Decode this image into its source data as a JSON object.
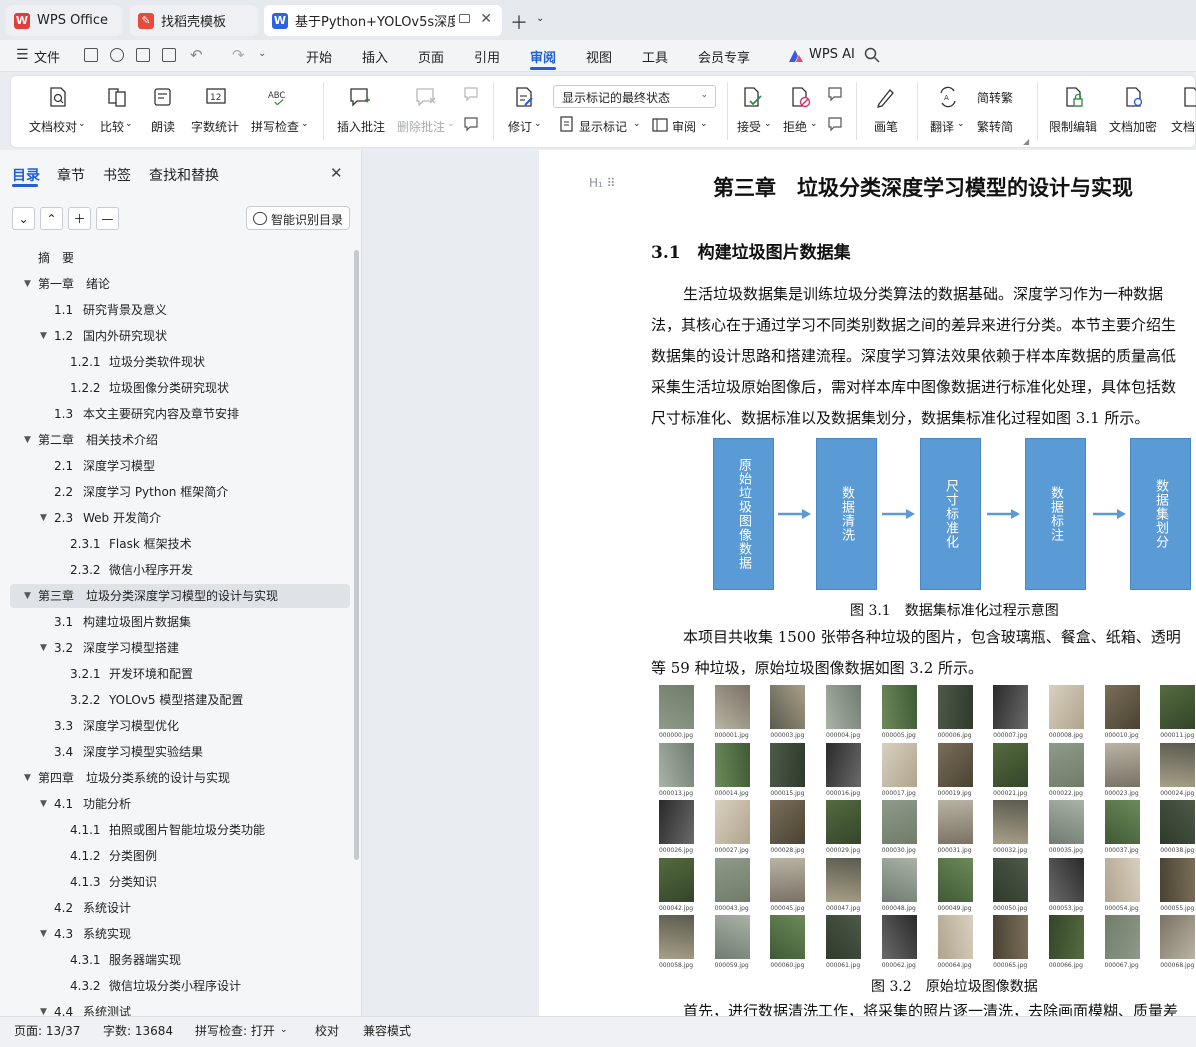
{
  "tabs": [
    {
      "label": "WPS Office",
      "icon": "wps-logo-icon",
      "color": "#e43b3b"
    },
    {
      "label": "找稻壳模板",
      "icon": "docer-logo-icon",
      "color": "#e84a3c"
    },
    {
      "label": "基于Python+YOLOv5s深度学",
      "icon": "writer-logo-icon",
      "color": "#2b63e0"
    }
  ],
  "menubar": {
    "file": "文件",
    "items": [
      "开始",
      "插入",
      "页面",
      "引用",
      "审阅",
      "视图",
      "工具",
      "会员专享"
    ],
    "active": "审阅",
    "ai": "WPS AI"
  },
  "ribbon": {
    "doc_check": "文档校对",
    "compare": "比较",
    "read_aloud": "朗读",
    "word_count": "字数统计",
    "spell_check": "拼写检查",
    "insert_comment": "插入批注",
    "delete_comment": "删除批注",
    "track_changes": "修订",
    "markup_select": "显示标记的最终状态",
    "show_markup": "显示标记",
    "review": "审阅",
    "accept": "接受",
    "reject": "拒绝",
    "pen": "画笔",
    "translate": "翻译",
    "to_traditional": "简转繁",
    "to_simplified": "繁转简",
    "restrict_edit": "限制编辑",
    "encrypt": "文档加密",
    "doc_more": "文档"
  },
  "navpane": {
    "tabs": [
      "目录",
      "章节",
      "书签",
      "查找和替换"
    ],
    "smart_toc": "智能识别目录",
    "toc": [
      {
        "num": "",
        "text": "摘　要",
        "level": 0,
        "arrow": false
      },
      {
        "num": "第一章",
        "text": "绪论",
        "level": 0,
        "arrow": true
      },
      {
        "num": "1.1",
        "text": "研究背景及意义",
        "level": 1,
        "arrow": false
      },
      {
        "num": "1.2",
        "text": "国内外研究现状",
        "level": 1,
        "arrow": true
      },
      {
        "num": "1.2.1",
        "text": "垃圾分类软件现状",
        "level": 2,
        "arrow": false
      },
      {
        "num": "1.2.2",
        "text": "垃圾图像分类研究现状",
        "level": 2,
        "arrow": false
      },
      {
        "num": "1.3",
        "text": "本文主要研究内容及章节安排",
        "level": 1,
        "arrow": false
      },
      {
        "num": "第二章",
        "text": "相关技术介绍",
        "level": 0,
        "arrow": true
      },
      {
        "num": "2.1",
        "text": "深度学习模型",
        "level": 1,
        "arrow": false
      },
      {
        "num": "2.2",
        "text": "深度学习 Python 框架简介",
        "level": 1,
        "arrow": false
      },
      {
        "num": "2.3",
        "text": "Web 开发简介",
        "level": 1,
        "arrow": true
      },
      {
        "num": "2.3.1",
        "text": "Flask 框架技术",
        "level": 2,
        "arrow": false
      },
      {
        "num": "2.3.2",
        "text": "微信小程序开发",
        "level": 2,
        "arrow": false
      },
      {
        "num": "第三章",
        "text": "垃圾分类深度学习模型的设计与实现",
        "level": 0,
        "arrow": true,
        "selected": true
      },
      {
        "num": "3.1",
        "text": "构建垃圾图片数据集",
        "level": 1,
        "arrow": false
      },
      {
        "num": "3.2",
        "text": "深度学习模型搭建",
        "level": 1,
        "arrow": true
      },
      {
        "num": "3.2.1",
        "text": "开发环境和配置",
        "level": 2,
        "arrow": false
      },
      {
        "num": "3.2.2",
        "text": "YOLOv5 模型搭建及配置",
        "level": 2,
        "arrow": false
      },
      {
        "num": "3.3",
        "text": "深度学习模型优化",
        "level": 1,
        "arrow": false
      },
      {
        "num": "3.4",
        "text": "深度学习模型实验结果",
        "level": 1,
        "arrow": false
      },
      {
        "num": "第四章",
        "text": "垃圾分类系统的设计与实现",
        "level": 0,
        "arrow": true
      },
      {
        "num": "4.1",
        "text": "功能分析",
        "level": 1,
        "arrow": true
      },
      {
        "num": "4.1.1",
        "text": "拍照或图片智能垃圾分类功能",
        "level": 2,
        "arrow": false
      },
      {
        "num": "4.1.2",
        "text": "分类图例",
        "level": 2,
        "arrow": false
      },
      {
        "num": "4.1.3",
        "text": "分类知识",
        "level": 2,
        "arrow": false
      },
      {
        "num": "4.2",
        "text": "系统设计",
        "level": 1,
        "arrow": false
      },
      {
        "num": "4.3",
        "text": "系统实现",
        "level": 1,
        "arrow": true
      },
      {
        "num": "4.3.1",
        "text": "服务器端实现",
        "level": 2,
        "arrow": false
      },
      {
        "num": "4.3.2",
        "text": "微信垃圾分类小程序设计",
        "level": 2,
        "arrow": false
      },
      {
        "num": "4.4",
        "text": "系统测试",
        "level": 1,
        "arrow": true
      }
    ]
  },
  "document": {
    "chapter_title": "第三章　垃圾分类深度学习模型的设计与实现",
    "section_title": "3.1　构建垃圾图片数据集",
    "para1": [
      "生活垃圾数据集是训练垃圾分类算法的数据基础。深度学习作为一种数据",
      "法，其核心在于通过学习不同类别数据之间的差异来进行分类。本节主要介绍生",
      "数据集的设计思路和搭建流程。深度学习算法效果依赖于样本库数据的质量高低",
      "采集生活垃圾原始图像后，需对样本库中图像数据进行标准化处理，具体包括数",
      "尺寸标准化、数据标准以及数据集划分，数据集标准化过程如图 3.1 所示。"
    ],
    "flow_steps": [
      "原始垃圾图像数据",
      "数据清洗",
      "尺寸标准化",
      "数据标注",
      "数据集划分"
    ],
    "fig1_caption": "图 3.1　数据集标准化过程示意图",
    "para2": [
      "本项目共收集 1500 张带各种垃圾的图片，包含玻璃瓶、餐盒、纸箱、透明",
      "等 59 种垃圾，原始垃圾图像数据如图 3.2 所示。"
    ],
    "thumbnails": [
      [
        "000000.jpg",
        "000001.jpg",
        "000003.jpg",
        "000004.jpg",
        "000005.jpg",
        "000006.jpg",
        "000007.jpg",
        "000008.jpg",
        "000010.jpg",
        "000011.jpg"
      ],
      [
        "000013.jpg",
        "000014.jpg",
        "000015.jpg",
        "000016.jpg",
        "000017.jpg",
        "000019.jpg",
        "000021.jpg",
        "000022.jpg",
        "000023.jpg",
        "000024.jpg"
      ],
      [
        "000026.jpg",
        "000027.jpg",
        "000028.jpg",
        "000029.jpg",
        "000030.jpg",
        "000031.jpg",
        "000032.jpg",
        "000035.jpg",
        "000037.jpg",
        "000038.jpg"
      ],
      [
        "000042.jpg",
        "000043.jpg",
        "000045.jpg",
        "000047.jpg",
        "000048.jpg",
        "000049.jpg",
        "000050.jpg",
        "000053.jpg",
        "000054.jpg",
        "000055.jpg"
      ],
      [
        "000058.jpg",
        "000059.jpg",
        "000060.jpg",
        "000061.jpg",
        "000062.jpg",
        "000064.jpg",
        "000065.jpg",
        "000066.jpg",
        "000067.jpg",
        "000068.jpg"
      ]
    ],
    "fig2_caption": "图 3.2　原始垃圾图像数据",
    "para3": "首先，进行数据清洗工作，将采集的照片逐一清洗，去除画面模糊、质量差"
  },
  "statusbar": {
    "page": "页面: 13/37",
    "words": "字数: 13684",
    "spell": "拼写检查: 打开",
    "proofread": "校对",
    "compat": "兼容模式"
  },
  "colors": {
    "accent": "#1f5fd8",
    "flow_box": "#5b9bd5",
    "flow_arrow": "#5b9bd5"
  }
}
